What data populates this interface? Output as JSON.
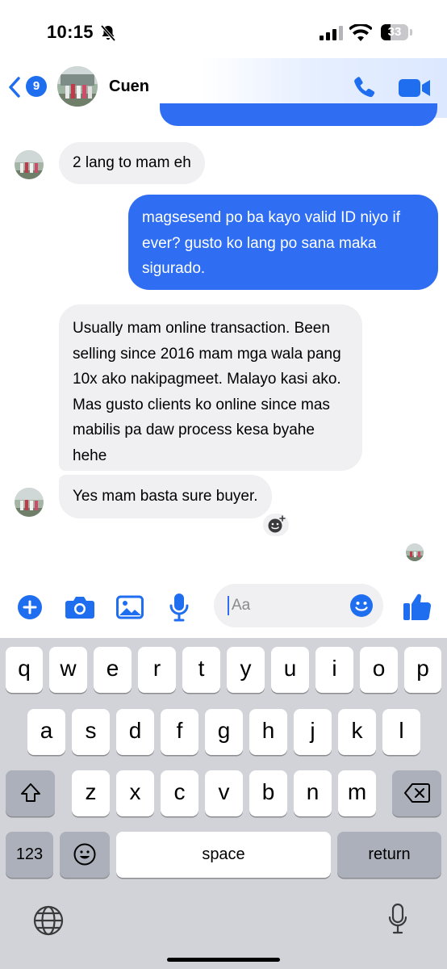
{
  "status_bar": {
    "time": "10:15",
    "battery_level": "33",
    "icons": [
      "bell-slash-icon",
      "signal-icon",
      "wifi-icon",
      "battery-icon"
    ]
  },
  "header": {
    "back_badge": "9",
    "contact_name": "Cuen",
    "icons": [
      "chevron-left-icon",
      "phone-icon",
      "video-camera-icon"
    ]
  },
  "messages": [
    {
      "direction": "incoming",
      "text": "2 lang to mam eh"
    },
    {
      "direction": "outgoing",
      "text": "magsesend po ba kayo valid ID niyo if ever? gusto ko lang po sana maka sigurado."
    },
    {
      "direction": "incoming",
      "text": "Usually mam online transaction. Been selling since 2016 mam mga wala pang 10x ako nakipagmeet. Malayo kasi ako. Mas gusto clients ko online since mas mabilis pa daw process kesa byahe hehe"
    },
    {
      "direction": "incoming",
      "text": "Yes mam basta sure buyer."
    }
  ],
  "composer": {
    "placeholder": "Aa",
    "icons": [
      "plus-icon",
      "camera-icon",
      "photo-icon",
      "microphone-icon",
      "emoji-icon",
      "thumbs-up-icon"
    ]
  },
  "keyboard": {
    "row1": [
      "q",
      "w",
      "e",
      "r",
      "t",
      "y",
      "u",
      "i",
      "o",
      "p"
    ],
    "row2": [
      "a",
      "s",
      "d",
      "f",
      "g",
      "h",
      "j",
      "k",
      "l"
    ],
    "row3": [
      "z",
      "x",
      "c",
      "v",
      "b",
      "n",
      "m"
    ],
    "numbers_label": "123",
    "space_label": "space",
    "return_label": "return",
    "icons": [
      "shift-icon",
      "backspace-icon",
      "emoji-keyboard-icon",
      "globe-icon",
      "dictation-mic-icon"
    ]
  },
  "colors": {
    "accent": "#1f6ef0",
    "outgoing_bubble": "#2f6ef2",
    "incoming_bubble": "#f0f0f2",
    "keyboard_bg": "#d2d3d8"
  }
}
